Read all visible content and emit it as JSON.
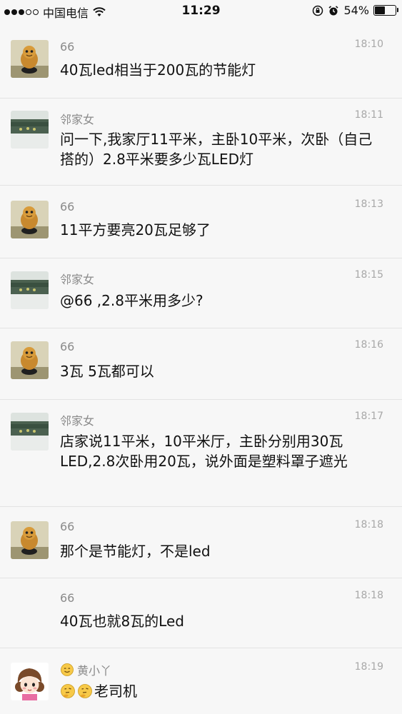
{
  "status_bar": {
    "carrier": "中国电信",
    "time": "11:29",
    "battery_percent": "54%",
    "battery_level": 0.54,
    "signal_icon": "signal-dots-icon",
    "wifi_icon": "wifi-icon",
    "lock_icon": "orientation-lock-icon",
    "alarm_icon": "alarm-icon"
  },
  "messages": [
    {
      "name": "66",
      "time": "18:10",
      "text": "40瓦led相当于200瓦的节能灯",
      "avatar": "doll-avatar"
    },
    {
      "name": "邻家女",
      "time": "18:11",
      "text": "问一下,我家厅11平米，主卧10平米，次卧（自己搭的）2.8平米要多少瓦LED灯",
      "avatar": "landscape-avatar"
    },
    {
      "name": "66",
      "time": "18:13",
      "text": "11平方要亮20瓦足够了",
      "avatar": "doll-avatar"
    },
    {
      "name": "邻家女",
      "time": "18:15",
      "text": "@66 ,2.8平米用多少?",
      "avatar": "landscape-avatar"
    },
    {
      "name": "66",
      "time": "18:16",
      "text": "3瓦 5瓦都可以",
      "avatar": "doll-avatar"
    },
    {
      "name": "邻家女",
      "time": "18:17",
      "text": "店家说11平米，10平米厅，主卧分别用30瓦LED,2.8次卧用20瓦，说外面是塑料罩子遮光",
      "avatar": "landscape-avatar"
    },
    {
      "name": "66",
      "time": "18:18",
      "text": "那个是节能灯，不是led",
      "avatar": "doll-avatar"
    },
    {
      "name": "66",
      "time": "18:18",
      "text": "40瓦也就8瓦的Led",
      "avatar": ""
    },
    {
      "name": "黄小丫",
      "time": "18:19",
      "text": "老司机",
      "avatar": "cartoon-girl-avatar",
      "name_prefix_emoji": "smile-emoji-icon",
      "text_prefix_emojis": [
        "thinking-emoji-icon",
        "thinking-emoji-icon"
      ]
    }
  ],
  "colors": {
    "background": "#f7f7f7",
    "divider": "#e3e3e3",
    "name_gray": "#8a8a8a",
    "time_gray": "#a8a8a8"
  }
}
